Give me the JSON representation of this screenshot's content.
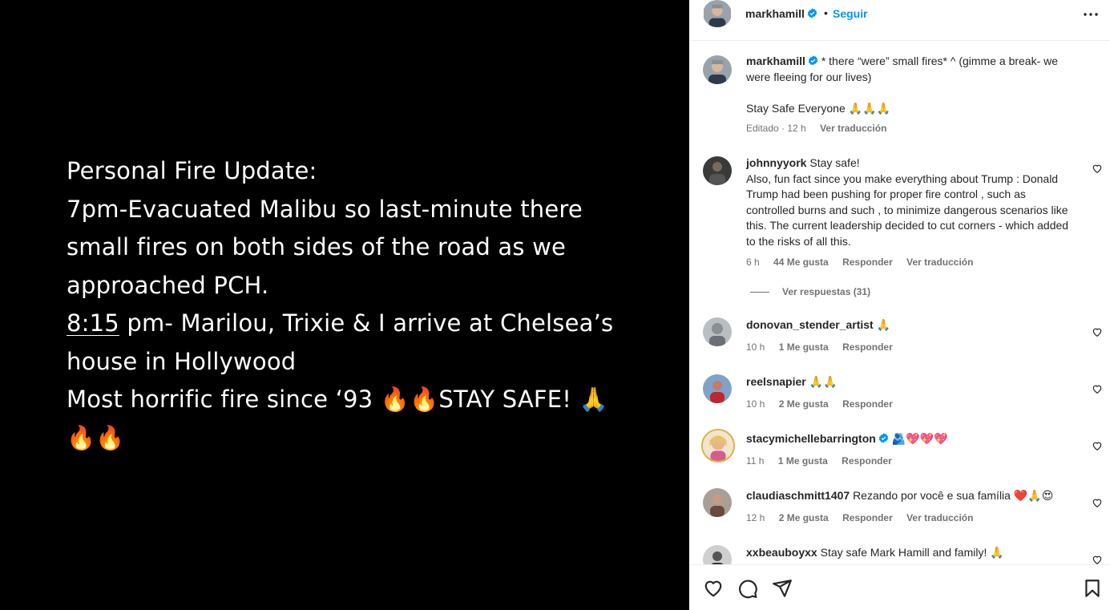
{
  "media": {
    "lines": [
      "Personal Fire Update:",
      "7pm-Evacuated Malibu so last-minute there",
      "small fires on both sides of the road as we",
      "approached PCH.",
      "pm- Marilou, Trixie & I arrive at Chelsea’s",
      "house in Hollywood",
      "Most horrific fire since ‘93 🔥🔥STAY SAFE! 🙏",
      "🔥🔥"
    ],
    "time_link": "8:15"
  },
  "header": {
    "username": "markhamill",
    "dot": "•",
    "follow_label": "Seguir"
  },
  "caption": {
    "username": "markhamill",
    "text": "* there “were” small fires* ^ (gimme a break- we were fleeing for our lives)",
    "text2": "Stay Safe Everyone 🙏🙏🙏",
    "meta_time": "Editado · 12 h",
    "translate": "Ver traducción"
  },
  "comments": [
    {
      "username": "johnnyyork",
      "text": "Stay safe!",
      "text_more": "Also, fun fact since you make everything about Trump : Donald Trump had been pushing for proper fire control , such as controlled burns and such , to minimize dangerous scenarios like this. The current leadership decided to cut corners - which added to the risks of all this.",
      "time": "6 h",
      "likes": "44 Me gusta",
      "reply": "Responder",
      "translate": "Ver traducción",
      "view_replies": "Ver respuestas (31)"
    },
    {
      "username": "donovan_stender_artist",
      "text": "🙏",
      "time": "10 h",
      "likes": "1 Me gusta",
      "reply": "Responder"
    },
    {
      "username": "reelsnapier",
      "text": "🙏🙏",
      "time": "10 h",
      "likes": "2 Me gusta",
      "reply": "Responder"
    },
    {
      "username": "stacymichellebarrington",
      "text": "🫂💖💖💖",
      "time": "11 h",
      "likes": "1 Me gusta",
      "reply": "Responder"
    },
    {
      "username": "claudiaschmitt1407",
      "text": "Rezando por você e sua família ❤️🙏😍",
      "time": "12 h",
      "likes": "2 Me gusta",
      "reply": "Responder",
      "translate": "Ver traducción"
    },
    {
      "username": "xxbeauboyxx",
      "text": "Stay safe Mark Hamill and family! 🙏"
    }
  ],
  "icons": {
    "verified": "verified-badge-icon",
    "more": "more-options-icon",
    "like": "heart-icon",
    "comment": "comment-icon",
    "share": "share-icon",
    "save": "bookmark-icon"
  },
  "colors": {
    "accent": "#0095f6",
    "text": "#262626",
    "muted": "#737373"
  }
}
